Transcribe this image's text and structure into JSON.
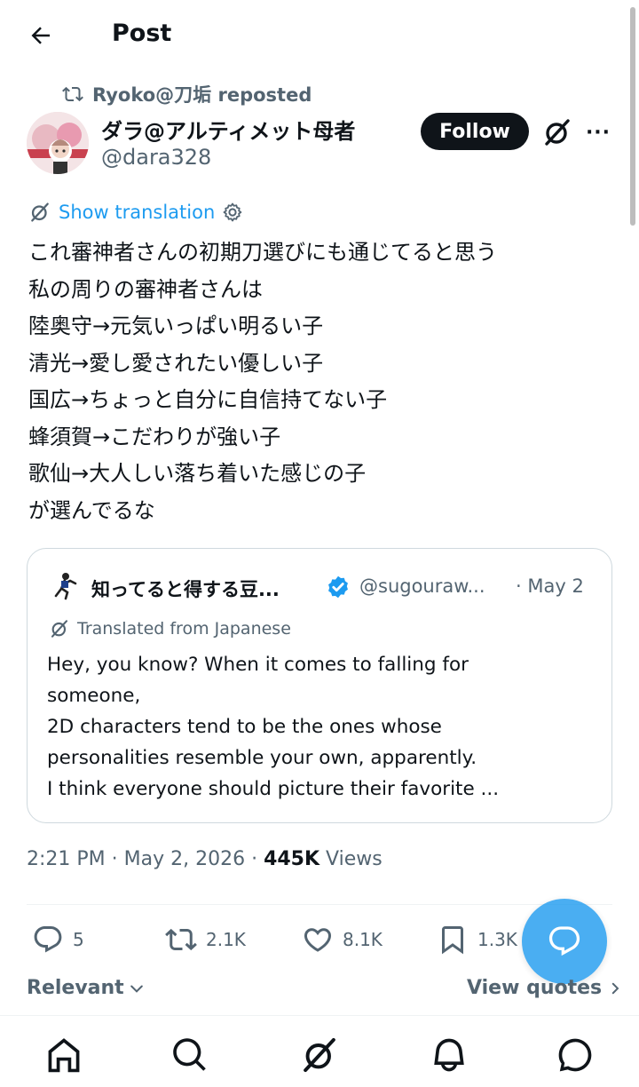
{
  "header": {
    "title": "Post"
  },
  "repost": {
    "text": "Ryoko@刀垢 reposted"
  },
  "author": {
    "name": "ダラ@アルティメット母者",
    "handle": "@dara328"
  },
  "follow_label": "Follow",
  "more_label": "···",
  "show_translation": "Show translation",
  "post_lines": [
    "これ審神者さんの初期刀選びにも通じてると思う",
    "私の周りの審神者さんは",
    "陸奥守→元気いっぱい明るい子",
    "清光→愛し愛されたい優しい子",
    "国広→ちょっと自分に自信持てない子",
    "蜂須賀→こだわりが強い子",
    "歌仙→大人しい落ち着いた感じの子",
    "が選んでるな"
  ],
  "quote": {
    "name": "知ってると得する豆...",
    "handle": "@sugouraw...",
    "date": "· May 2",
    "translated_label": "Translated from Japanese",
    "lines": [
      "Hey, you know? When it comes to falling for",
      "someone,",
      "2D characters tend to be the ones whose",
      "personalities resemble your own, apparently.",
      "I think everyone should picture their favorite ..."
    ]
  },
  "meta": {
    "time_date": "2:21 PM · May 2, 2026 · ",
    "views_count": "445K",
    "views_label": " Views"
  },
  "actions": {
    "replies": "5",
    "reposts": "2.1K",
    "likes": "8.1K",
    "bookmarks": "1.3K"
  },
  "sort_label": "Relevant",
  "view_quotes_label": "View quotes",
  "colors": {
    "accent": "#1d9bf0",
    "text": "#0f1419",
    "muted": "#536471",
    "border": "#cfd9de"
  },
  "icons": [
    "back-arrow-icon",
    "repost-icon",
    "grok-icon",
    "more-icon",
    "gear-icon",
    "verified-badge-icon",
    "reply-icon",
    "like-icon",
    "bookmark-icon",
    "compose-reply-icon",
    "home-icon",
    "search-icon",
    "notifications-icon",
    "messages-icon"
  ]
}
